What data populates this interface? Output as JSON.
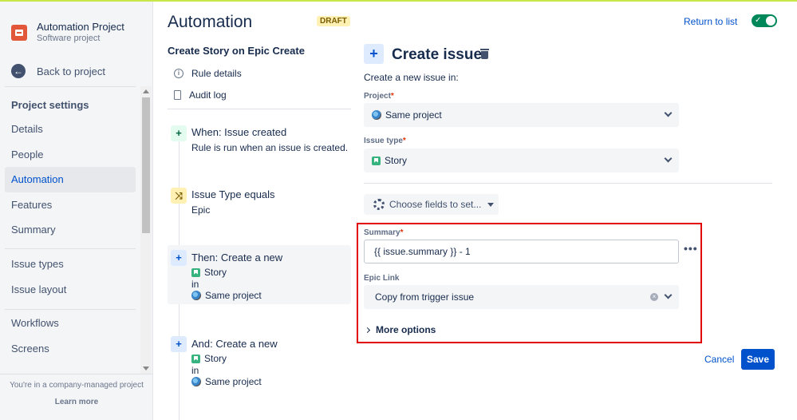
{
  "project": {
    "name": "Automation Project",
    "type": "Software project"
  },
  "sidebar": {
    "back_label": "Back to project",
    "section_title": "Project settings",
    "items": [
      {
        "label": "Details",
        "active": false
      },
      {
        "label": "People",
        "active": false
      },
      {
        "label": "Automation",
        "active": true
      },
      {
        "label": "Features",
        "active": false
      },
      {
        "label": "Summary",
        "active": false
      },
      {
        "label": "Issue types",
        "active": false
      },
      {
        "label": "Issue layout",
        "active": false
      },
      {
        "label": "Workflows",
        "active": false
      },
      {
        "label": "Screens",
        "active": false
      }
    ],
    "footer_text": "You're in a company-managed project",
    "learn_more": "Learn more"
  },
  "page": {
    "title": "Automation",
    "badge": "DRAFT",
    "return_link": "Return to list",
    "rule_enabled": true
  },
  "rule": {
    "name": "Create Story on Epic Create",
    "menu": {
      "details": "Rule details",
      "audit": "Audit log"
    },
    "steps": {
      "trigger": {
        "title": "When: Issue created",
        "desc": "Rule is run when an issue is created."
      },
      "condition": {
        "title": "Issue Type equals",
        "value": "Epic"
      },
      "action1": {
        "title": "Then: Create a new",
        "type": "Story",
        "in": "in",
        "project": "Same project"
      },
      "action2": {
        "title": "And: Create a new",
        "type": "Story",
        "in": "in",
        "project": "Same project"
      }
    }
  },
  "panel": {
    "title": "Create issue",
    "subtitle": "Create a new issue in:",
    "project_label": "Project",
    "project_value": "Same project",
    "issue_type_label": "Issue type",
    "issue_type_value": "Story",
    "choose_fields": "Choose fields to set...",
    "summary_label": "Summary",
    "summary_value": "{{ issue.summary }} - 1",
    "epic_link_label": "Epic Link",
    "epic_link_value": "Copy from trigger issue",
    "more_options": "More options",
    "cancel": "Cancel",
    "save": "Save",
    "required_mark": "*"
  },
  "colors": {
    "accent": "#0052cc",
    "toggle_on": "#00875a",
    "highlight_border": "#e00000",
    "draft_bg": "#fff0b3"
  }
}
